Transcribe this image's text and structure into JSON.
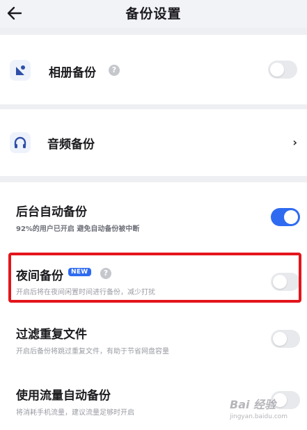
{
  "header": {
    "title": "备份设置"
  },
  "album": {
    "label": "相册备份",
    "help": "?",
    "enabled": false
  },
  "audio": {
    "label": "音频备份",
    "chevron": "›"
  },
  "settings": [
    {
      "label": "后台自动备份",
      "desc": "92%的用户已开启 避免自动备份被中断",
      "enabled": true
    },
    {
      "label": "夜间备份",
      "badge": "NEW",
      "help": "?",
      "desc": "开启后将在夜间闲置时间进行备份，减少打扰",
      "enabled": false
    },
    {
      "label": "过滤重复文件",
      "desc": "开启后备份将跳过重复文件，有助于节省网盘容量",
      "enabled": false
    },
    {
      "label": "使用流量自动备份",
      "desc": "将消耗手机流量，建议流量足够时开启",
      "enabled": false
    }
  ],
  "watermark": {
    "main": "Bai 经验",
    "sub": "jingyan.baidu.com"
  },
  "colors": {
    "accent": "#2f6bf0",
    "highlight": "#e3151c",
    "toggle_off": "#e8e9ec"
  }
}
